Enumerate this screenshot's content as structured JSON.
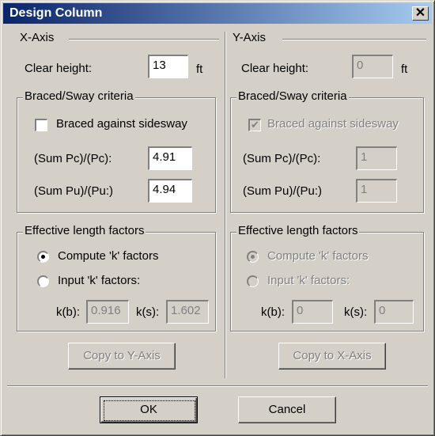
{
  "window": {
    "title": "Design Column"
  },
  "x_axis": {
    "title": "X-Axis",
    "clear_height_label": "Clear height:",
    "clear_height_value": "13",
    "unit": "ft",
    "braced_group": "Braced/Sway criteria",
    "braced_label": "Braced against sidesway",
    "sum_pc_label": "(Sum Pc)/(Pc):",
    "sum_pc_value": "4.91",
    "sum_pu_label": "(Sum Pu)/(Pu:)",
    "sum_pu_value": "4.94",
    "eff_group": "Effective length factors",
    "compute_label": "Compute 'k' factors",
    "input_label": "Input 'k' factors:",
    "kb_label": "k(b):",
    "kb_value": "0.916",
    "ks_label": "k(s):",
    "ks_value": "1.602",
    "copy_button": "Copy to Y-Axis"
  },
  "y_axis": {
    "title": "Y-Axis",
    "clear_height_label": "Clear height:",
    "clear_height_value": "0",
    "unit": "ft",
    "braced_group": "Braced/Sway criteria",
    "braced_label": "Braced against sidesway",
    "braced_check": "✔",
    "sum_pc_label": "(Sum Pc)/(Pc):",
    "sum_pc_value": "1",
    "sum_pu_label": "(Sum Pu)/(Pu:)",
    "sum_pu_value": "1",
    "eff_group": "Effective length factors",
    "compute_label": "Compute 'k' factors",
    "input_label": "Input 'k' factors:",
    "kb_label": "k(b):",
    "kb_value": "0",
    "ks_label": "k(s):",
    "ks_value": "0",
    "copy_button": "Copy to X-Axis"
  },
  "footer": {
    "ok": "OK",
    "cancel": "Cancel"
  },
  "icons": {
    "close": "✕"
  }
}
